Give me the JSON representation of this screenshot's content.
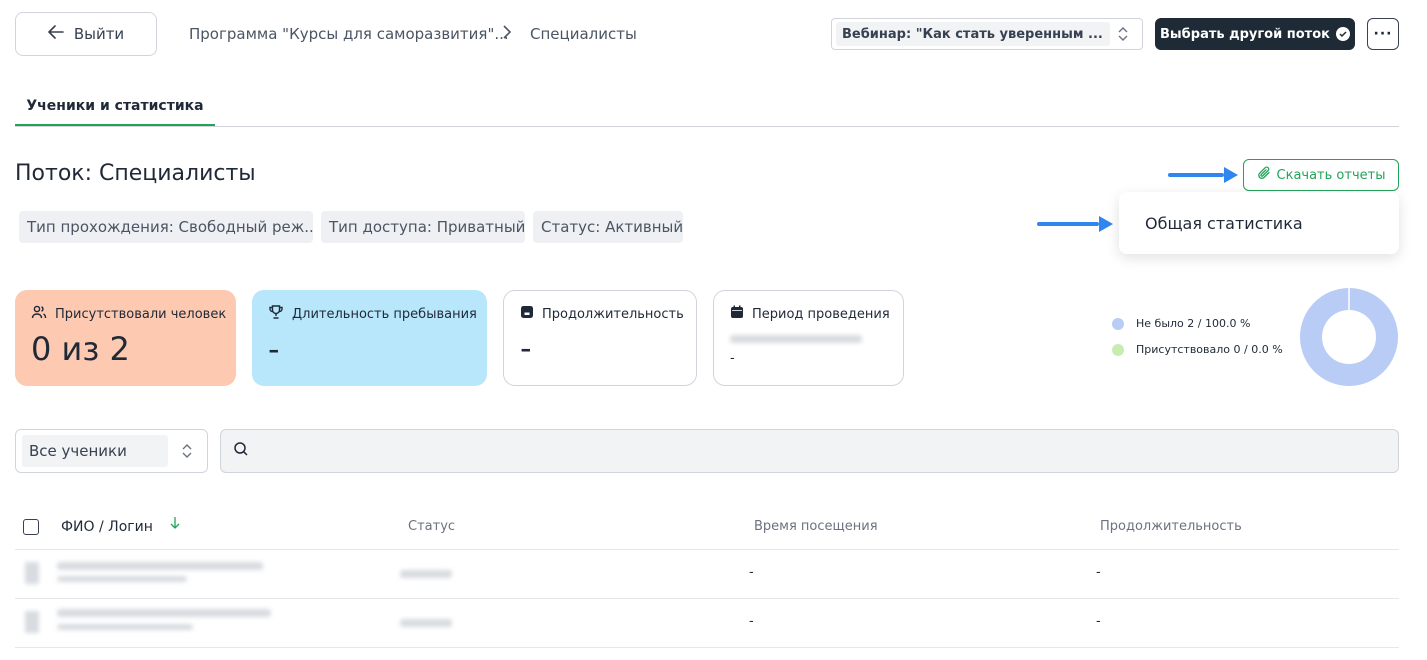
{
  "header": {
    "back_label": "Выйти",
    "breadcrumb_program": "Программа \"Курсы для саморазвития\"...",
    "breadcrumb_current": "Специалисты",
    "stream_select_value": "Вебинар: \"Как стать уверенным ...",
    "choose_stream_label": "Выбрать другой поток",
    "more_label": "···"
  },
  "tabs": [
    {
      "label": "Ученики и статистика",
      "active": true
    }
  ],
  "page": {
    "title": "Поток: Специалисты",
    "chips": [
      "Тип прохождения: Свободный реж...",
      "Тип доступа: Приватный",
      "Статус: Активный"
    ],
    "download_label": "Скачать отчеты",
    "dropdown_item": "Общая статистика"
  },
  "stats": [
    {
      "label": "Присутствовали человек",
      "value": "0 из 2",
      "icon": "users-icon",
      "bg": "#fdc9b0"
    },
    {
      "label": "Длительность пребывания",
      "value": "-",
      "icon": "trophy-icon",
      "bg": "#b8e6fb"
    },
    {
      "label": "Продолжительность",
      "value": "-",
      "icon": "timer-icon",
      "bg": "#ffffff"
    },
    {
      "label": "Период проведения",
      "value": "-",
      "icon": "calendar-icon",
      "bg": "#ffffff"
    }
  ],
  "legend": [
    {
      "label": "Не было 2 / 100.0 %",
      "color": "#b9ccf6"
    },
    {
      "label": "Присутствовало 0 / 0.0 %",
      "color": "#c8ecb0"
    }
  ],
  "chart_data": {
    "type": "pie",
    "categories": [
      "Не было",
      "Присутствовало"
    ],
    "values": [
      2,
      0
    ],
    "colors": [
      "#b9ccf6",
      "#c8ecb0"
    ]
  },
  "filters": {
    "students_select_value": "Все ученики",
    "search_placeholder": ""
  },
  "table": {
    "columns": [
      "ФИО / Логин",
      "Статус",
      "Время посещения",
      "Продолжительность"
    ],
    "rows": [
      {
        "visit_time": "-",
        "duration": "-"
      },
      {
        "visit_time": "-",
        "duration": "-"
      }
    ]
  },
  "colors": {
    "accent_green": "#22a35a",
    "dark_button": "#1f2a37",
    "annotation_arrow": "#2f86f0"
  }
}
